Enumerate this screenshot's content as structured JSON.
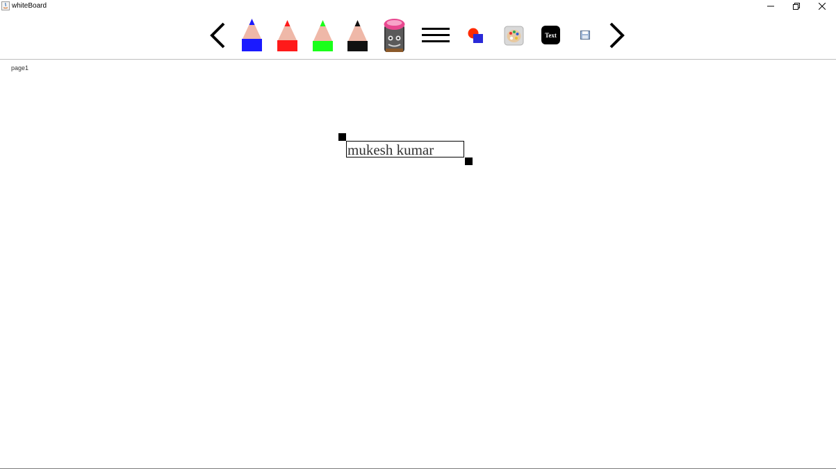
{
  "window": {
    "title": "whiteBoard"
  },
  "titlebar_controls": {
    "minimize_icon": "minimize-icon",
    "restore_icon": "restore-icon",
    "close_icon": "close-icon"
  },
  "toolbar": {
    "tools": [
      {
        "name": "previous-page",
        "icon": "chevron-left-icon"
      },
      {
        "name": "blue-pencil",
        "icon": "pencil-icon",
        "color": "#1a1aff"
      },
      {
        "name": "red-pencil",
        "icon": "pencil-icon",
        "color": "#ff1a1a"
      },
      {
        "name": "green-pencil",
        "icon": "pencil-icon",
        "color": "#1aff1a"
      },
      {
        "name": "black-pencil",
        "icon": "pencil-icon",
        "color": "#111111"
      },
      {
        "name": "eraser",
        "icon": "eraser-icon",
        "color": "#e8478f"
      },
      {
        "name": "stroke-width",
        "icon": "lines-icon"
      },
      {
        "name": "shapes",
        "icon": "shapes-icon"
      },
      {
        "name": "color-palette",
        "icon": "palette-icon"
      },
      {
        "name": "text-tool",
        "icon": "text-icon"
      },
      {
        "name": "save",
        "icon": "floppy-disk-icon"
      },
      {
        "name": "next-page",
        "icon": "chevron-right-icon"
      }
    ],
    "text_tool_label": "Text"
  },
  "canvas": {
    "page_label": "page1",
    "text_box": {
      "value": "mukesh kumar"
    }
  },
  "colors": {
    "pencil_wood": "#efb8a8",
    "blue": "#1a1aff",
    "red": "#ff1a1a",
    "green": "#1aff1a",
    "black": "#111111",
    "eraser_pink": "#e8478f"
  }
}
